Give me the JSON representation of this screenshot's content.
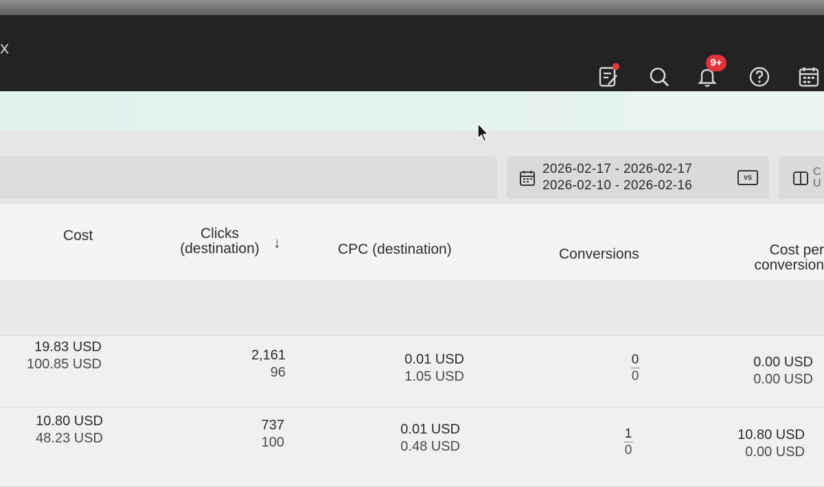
{
  "header": {
    "close_glyph": "x",
    "icons": [
      "edit-notes-icon",
      "search-icon",
      "bell-icon",
      "help-icon",
      "calendar-icon"
    ],
    "notification_badge": "9+",
    "accent_red": "#e2333b"
  },
  "filters": {
    "date_range_current": "2026-02-17 - 2026-02-17",
    "date_range_compare": "2026-02-10 - 2026-02-16",
    "compare_label": "VS",
    "columns_label_partial_1": "C",
    "columns_label_partial_2": "U"
  },
  "table": {
    "columns": {
      "cost": "Cost",
      "clicks_1": "Clicks",
      "clicks_2": "(destination)",
      "sort_glyph": "↓",
      "cpc": "CPC (destination)",
      "conversions": "Conversions",
      "cpconv_1": "Cost per",
      "cpconv_2": "conversion"
    },
    "rows": [
      {
        "cost": "19.83 USD",
        "cost_prev": "100.85 USD",
        "clicks": "2,161",
        "clicks_prev": "96",
        "cpc": "0.01 USD",
        "cpc_prev": "1.05 USD",
        "conversions": "0",
        "conversions_prev": "0",
        "cpconv": "0.00 USD",
        "cpconv_prev": "0.00 USD"
      },
      {
        "cost": "10.80 USD",
        "cost_prev": "48.23 USD",
        "clicks": "737",
        "clicks_prev": "100",
        "cpc": "0.01 USD",
        "cpc_prev": "0.48 USD",
        "conversions": "1",
        "conversions_prev": "0",
        "cpconv": "10.80 USD",
        "cpconv_prev": "0.00 USD"
      }
    ]
  }
}
